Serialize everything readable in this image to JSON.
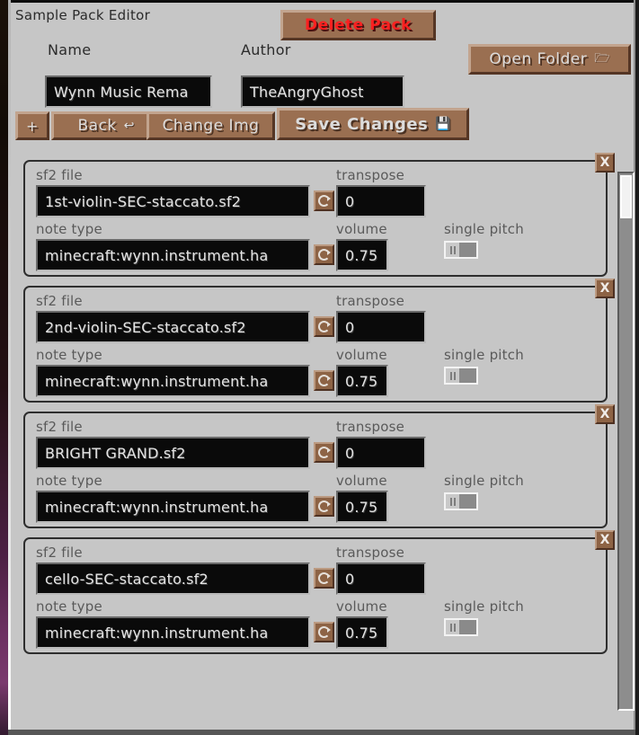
{
  "window": {
    "title": "Sample Pack Editor"
  },
  "header": {
    "name_label": "Name",
    "author_label": "Author",
    "name_value": "Wynn Music Rema",
    "author_value": "TheAngryGhost",
    "delete_pack_label": "Delete Pack",
    "open_folder_label": "Open Folder",
    "open_folder_icon": "folder-open-icon"
  },
  "toolbar": {
    "add_label": "+",
    "back_label": "Back",
    "back_icon": "return-arrow-icon",
    "change_img_label": "Change Img",
    "save_label": "Save Changes",
    "save_icon": "floppy-disk-icon"
  },
  "labels": {
    "sf2_file": "sf2 file",
    "note_type": "note type",
    "transpose": "transpose",
    "volume": "volume",
    "single_pitch": "single pitch",
    "close": "X"
  },
  "colors": {
    "background": "#c6c6c6",
    "button_face": "#9a6f51",
    "button_light": "#c2a48e",
    "button_dark": "#553625",
    "input_background": "#0a0a0a",
    "input_text": "#e4e4e4",
    "label_text": "#5a5a5a",
    "danger_text": "#fb2020",
    "panel_border": "#2e2e2e"
  },
  "samples": [
    {
      "sf2_file": "1st-violin-SEC-staccato.sf2",
      "note_type": "minecraft:wynn.instrument.ha",
      "transpose": "0",
      "volume": "0.75",
      "single_pitch": "off"
    },
    {
      "sf2_file": "2nd-violin-SEC-staccato.sf2",
      "note_type": "minecraft:wynn.instrument.ha",
      "transpose": "0",
      "volume": "0.75",
      "single_pitch": "off"
    },
    {
      "sf2_file": "BRIGHT GRAND.sf2",
      "note_type": "minecraft:wynn.instrument.ha",
      "transpose": "0",
      "volume": "0.75",
      "single_pitch": "off"
    },
    {
      "sf2_file": "cello-SEC-staccato.sf2",
      "note_type": "minecraft:wynn.instrument.ha",
      "transpose": "0",
      "volume": "0.75",
      "single_pitch": "off"
    }
  ]
}
